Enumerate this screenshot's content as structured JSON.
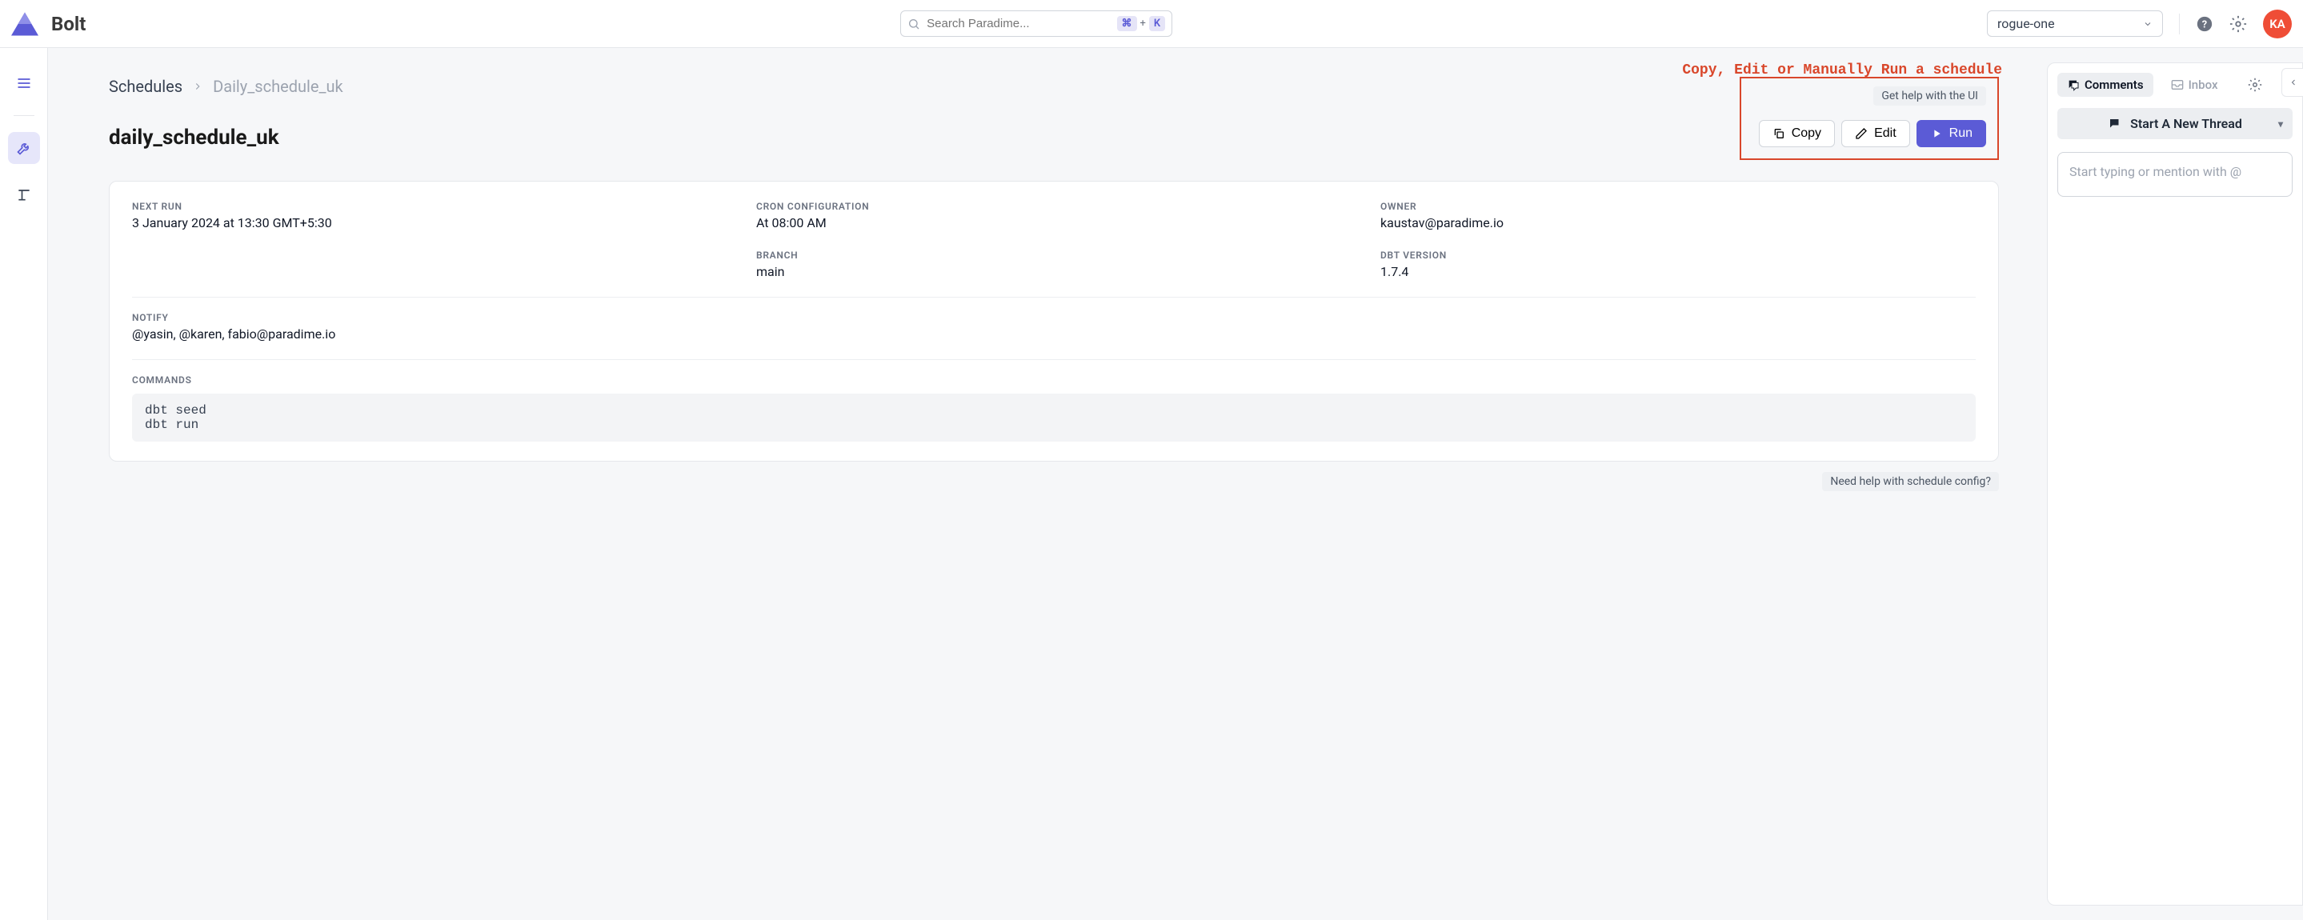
{
  "header": {
    "app_name": "Bolt",
    "search_placeholder": "Search Paradime...",
    "kbd_mod": "⌘",
    "kbd_plus": "+",
    "kbd_key": "K",
    "workspace": "rogue-one",
    "avatar": "KA"
  },
  "annotation": "Copy, Edit or Manually Run a schedule",
  "breadcrumb": {
    "root": "Schedules",
    "leaf": "Daily_schedule_uk"
  },
  "page_title": "daily_schedule_uk",
  "help_link": "Get help with the UI",
  "buttons": {
    "copy": "Copy",
    "edit": "Edit",
    "run": "Run"
  },
  "fields": {
    "next_run_label": "NEXT RUN",
    "next_run_value": "3 January 2024 at 13:30 GMT+5:30",
    "cron_label": "CRON CONFIGURATION",
    "cron_value": "At 08:00 AM",
    "owner_label": "OWNER",
    "owner_value": "kaustav@paradime.io",
    "branch_label": "BRANCH",
    "branch_value": "main",
    "dbt_label": "DBT VERSION",
    "dbt_value": "1.7.4",
    "notify_label": "NOTIFY",
    "notify_value": "@yasin, @karen, fabio@paradime.io",
    "commands_label": "COMMANDS",
    "commands_value": "dbt seed\ndbt run"
  },
  "footer_help": "Need help with schedule config?",
  "panel": {
    "comments": "Comments",
    "inbox": "Inbox",
    "thread_btn": "Start A New Thread",
    "compose_placeholder": "Start typing or mention with @"
  }
}
